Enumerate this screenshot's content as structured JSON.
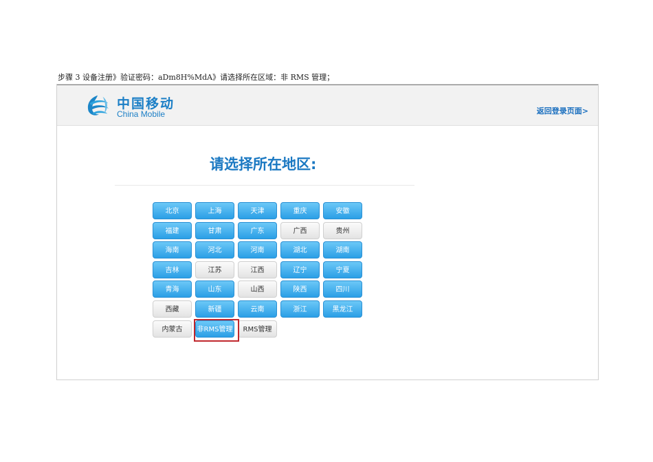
{
  "caption": "步骤 3  设备注册》验证密码：aDm8H%MdA》请选择所在区域：非 RMS 管理；",
  "header": {
    "logo_cn": "中国移动",
    "logo_en": "China Mobile",
    "back_link": "返回登录页面>"
  },
  "main": {
    "title": "请选择所在地区:"
  },
  "regions": [
    {
      "label": "北京",
      "style": "blue"
    },
    {
      "label": "上海",
      "style": "blue"
    },
    {
      "label": "天津",
      "style": "blue"
    },
    {
      "label": "重庆",
      "style": "blue"
    },
    {
      "label": "安徽",
      "style": "blue"
    },
    {
      "label": "福建",
      "style": "blue"
    },
    {
      "label": "甘肃",
      "style": "blue"
    },
    {
      "label": "广东",
      "style": "blue"
    },
    {
      "label": "广西",
      "style": "gray"
    },
    {
      "label": "贵州",
      "style": "gray"
    },
    {
      "label": "海南",
      "style": "blue"
    },
    {
      "label": "河北",
      "style": "blue"
    },
    {
      "label": "河南",
      "style": "blue"
    },
    {
      "label": "湖北",
      "style": "blue"
    },
    {
      "label": "湖南",
      "style": "blue"
    },
    {
      "label": "吉林",
      "style": "blue"
    },
    {
      "label": "江苏",
      "style": "gray"
    },
    {
      "label": "江西",
      "style": "gray"
    },
    {
      "label": "辽宁",
      "style": "blue"
    },
    {
      "label": "宁夏",
      "style": "blue"
    },
    {
      "label": "青海",
      "style": "blue"
    },
    {
      "label": "山东",
      "style": "blue"
    },
    {
      "label": "山西",
      "style": "gray"
    },
    {
      "label": "陕西",
      "style": "blue"
    },
    {
      "label": "四川",
      "style": "blue"
    },
    {
      "label": "西藏",
      "style": "gray"
    },
    {
      "label": "新疆",
      "style": "blue"
    },
    {
      "label": "云南",
      "style": "blue"
    },
    {
      "label": "浙江",
      "style": "blue"
    },
    {
      "label": "黑龙江",
      "style": "blue"
    },
    {
      "label": "内蒙古",
      "style": "gray"
    },
    {
      "label": "非RMS管理",
      "style": "blue",
      "selected": true
    },
    {
      "label": "RMS管理",
      "style": "gray"
    }
  ],
  "colors": {
    "accent": "#1a78c2",
    "button_blue": "#2b9fe6",
    "highlight": "#c0272d"
  },
  "icons": {
    "logo": "china-mobile-logo-icon"
  }
}
